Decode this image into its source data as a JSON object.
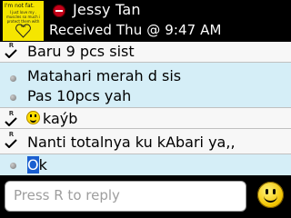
{
  "header": {
    "contact_name": "Jessy Tan",
    "received": "Received Thu @ 9:47 AM",
    "status_color": "#c4001a",
    "avatar": {
      "title": "I'm not fat.",
      "caption": "I just love my . muscles so much i protect them with fat"
    }
  },
  "messages": [
    {
      "direction": "sent",
      "status": "R",
      "text": "Baru 9 pcs sist"
    },
    {
      "direction": "received",
      "text": "Matahari merah d sis",
      "text2": "Pas 10pcs yah"
    },
    {
      "direction": "sent",
      "status": "R",
      "text": "kaýb"
    },
    {
      "direction": "sent",
      "status": "R",
      "text": "Nanti totalnya ku kAbari ya,,"
    },
    {
      "direction": "received",
      "text_cursor": "O",
      "text_rest": "k"
    }
  ],
  "compose": {
    "placeholder": "Press R to reply",
    "emoticon_icon": "smiley-icon"
  },
  "colors": {
    "sent_bg": "#f7f7f7",
    "received_bg": "#d5eef7",
    "selection": "#1a5fd0"
  }
}
